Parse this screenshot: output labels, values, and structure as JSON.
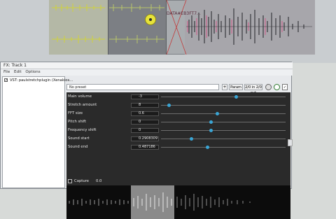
{
  "arrange": {
    "clip_label": "DATA#EB3FT7..."
  },
  "fx_window": {
    "title": "FX: Track 1",
    "menu": [
      "File",
      "Edit",
      "Options"
    ],
    "plugin_name": "VST: paulstretchplugin (Xenakios...",
    "preset": "No preset",
    "preset_plus": "+",
    "param_button": "Param",
    "io_button": "2/0 in 2/0 out",
    "power_check": "✓"
  },
  "plugin": {
    "params": [
      {
        "label": "Main volume",
        "value": "-3",
        "level": 0.6
      },
      {
        "label": "Stretch amount",
        "value": "8",
        "level": 0.06
      },
      {
        "label": "FFT size",
        "value": "0.6",
        "level": 0.45
      },
      {
        "label": "Pitch shift",
        "value": "0",
        "level": 0.4
      },
      {
        "label": "Frequency shift",
        "value": "0",
        "level": 0.4
      },
      {
        "label": "Sound start",
        "value": "0.2908309",
        "level": 0.24
      },
      {
        "label": "Sound end",
        "value": "0.487186",
        "level": 0.37
      }
    ],
    "capture_label": "Capture",
    "capture_value": "0.0"
  },
  "colors": {
    "accent_knob": "#3aa6d6",
    "plugin_bg": "#2a2a2a",
    "wave_pink": "#d05a8a"
  }
}
